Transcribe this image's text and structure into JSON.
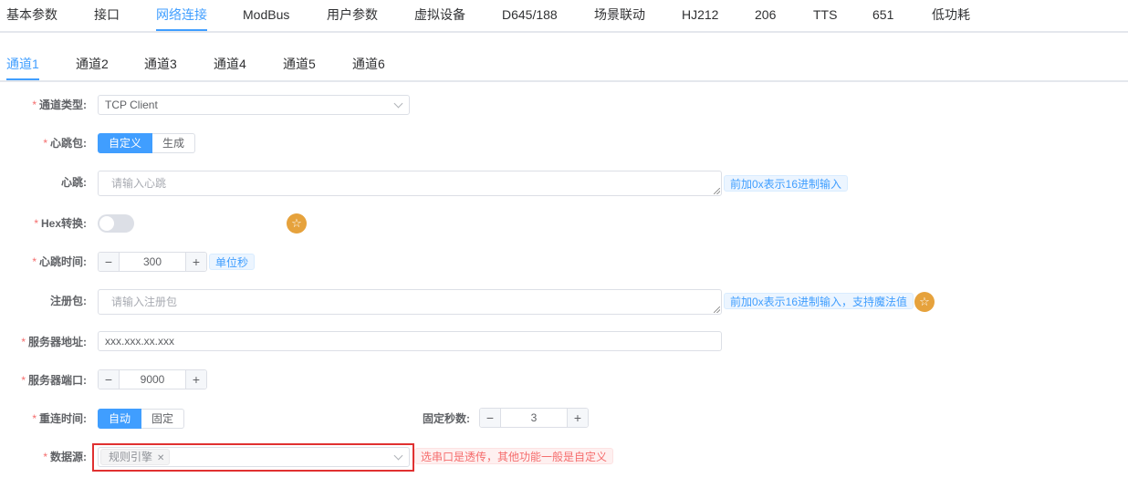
{
  "top_tabs": [
    {
      "label": "基本参数"
    },
    {
      "label": "接口"
    },
    {
      "label": "网络连接"
    },
    {
      "label": "ModBus"
    },
    {
      "label": "用户参数"
    },
    {
      "label": "虚拟设备"
    },
    {
      "label": "D645/188"
    },
    {
      "label": "场景联动"
    },
    {
      "label": "HJ212"
    },
    {
      "label": "206"
    },
    {
      "label": "TTS"
    },
    {
      "label": "651"
    },
    {
      "label": "低功耗"
    }
  ],
  "active_top_tab": "网络连接",
  "channel_tabs": [
    {
      "label": "通道1"
    },
    {
      "label": "通道2"
    },
    {
      "label": "通道3"
    },
    {
      "label": "通道4"
    },
    {
      "label": "通道5"
    },
    {
      "label": "通道6"
    }
  ],
  "active_channel_tab": "通道1",
  "form": {
    "required_mark": "*",
    "channel_type": {
      "label": "通道类型:",
      "value": "TCP Client"
    },
    "heartbeat_pkg": {
      "label": "心跳包:",
      "options": [
        "自定义",
        "生成"
      ],
      "selected": "自定义"
    },
    "heartbeat": {
      "label": "心跳:",
      "placeholder": "请输入心跳",
      "hint": "前加0x表示16进制输入"
    },
    "hex_convert": {
      "label": "Hex转换:",
      "on": false
    },
    "heartbeat_time": {
      "label": "心跳时间:",
      "value": "300",
      "unit": "单位秒"
    },
    "register_pkg": {
      "label": "注册包:",
      "placeholder": "请输入注册包",
      "hint": "前加0x表示16进制输入，支持魔法值"
    },
    "server_address": {
      "label": "服务器地址:",
      "value": "xxx.xxx.xx.xxx"
    },
    "server_port": {
      "label": "服务器端口:",
      "value": "9000"
    },
    "reconnect_time": {
      "label": "重连时间:",
      "options": [
        "自动",
        "固定"
      ],
      "selected": "自动"
    },
    "fixed_seconds": {
      "label": "固定秒数:",
      "value": "3"
    },
    "data_source": {
      "label": "数据源:",
      "tag": "规则引擎",
      "hint": "选串口是透传，其他功能一般是自定义"
    }
  },
  "colors": {
    "accent": "#409eff",
    "warning": "#e6a23c",
    "danger": "#f56c6c",
    "highlight": "#e03131"
  },
  "icons": {
    "star": "star-icon",
    "close": "close-icon",
    "chevron": "chevron-down-icon",
    "minus": "minus-icon",
    "plus": "plus-icon"
  }
}
